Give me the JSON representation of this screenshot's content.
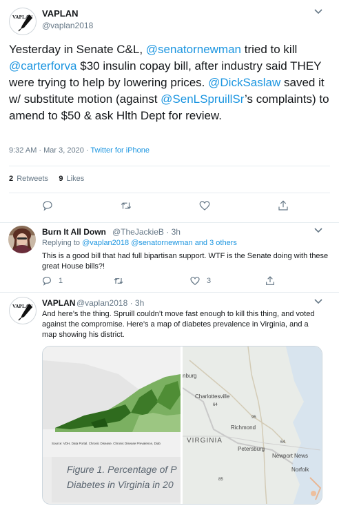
{
  "main_tweet": {
    "author": "VAPLAN",
    "handle": "@vaplan2018",
    "avatar_text": "VAPLAN",
    "body": {
      "t1": "Yesterday in Senate C&L, ",
      "m1": "@senatornewman",
      "t2": " tried to kill ",
      "m2": "@carterforva",
      "t3": " $30 insulin copay bill, after industry said THEY were trying to help by lowering prices. ",
      "m3": "@DickSaslaw",
      "t4": " saved it w/ substitute motion (against ",
      "m4": "@SenLSpruillSr",
      "t5": "’s complaints) to amend to $50 & ask Hlth Dept for review."
    },
    "timestamp": "9:32 AM · Mar 3, 2020 · ",
    "source": "Twitter for iPhone",
    "retweets_count": "2",
    "retweets_label": "Retweets",
    "likes_count": "9",
    "likes_label": "Likes"
  },
  "reply_1": {
    "author": "Burn It All Down",
    "handle": "@TheJackieB",
    "time": "· 3h",
    "replying_prefix": "Replying to ",
    "replying_to": "@vaplan2018 @senatornewman and 3 others",
    "text": "This is a good bill that had full bipartisan support. WTF is the Senate doing with these great House bills?!",
    "reply_count": "1",
    "retweet_count": "",
    "like_count": "3"
  },
  "reply_2": {
    "author": "VAPLAN",
    "handle": "@vaplan2018",
    "time": "· 3h",
    "avatar_text": "VAPLAN",
    "text": "And here’s the thing. Spruill couldn’t move fast enough to kill this thing, and voted against the compromise. Here’s a map of diabetes prevalence in Virginia, and a map showing his district.",
    "card": {
      "map_source": "Source: VDH, Data Portal. Chronic Disease. Chronic Disease Prevalence, Diab",
      "caption_line1": "Figure 1. Percentage of P",
      "caption_line2": "Diabetes in Virginia in 20",
      "map_labels": {
        "charlottesville": "Charlottesville",
        "richmond": "Richmond",
        "virginia": "VIRGINIA",
        "petersburg": "Petersburg",
        "newport_news": "Newport News",
        "norfolk": "Norfolk",
        "burg": "nburg",
        "route_64a": "64",
        "route_64b": "64",
        "route_95": "95",
        "route_85": "85"
      }
    }
  },
  "colors": {
    "link": "#1b95e0",
    "muted": "#657786",
    "text": "#14171a",
    "divider": "#e6ecf0",
    "map_dark_green": "#2f6b1e",
    "map_light_green": "#7bb061"
  },
  "icons": [
    "caret-down-icon",
    "reply-icon",
    "retweet-icon",
    "like-icon",
    "share-icon",
    "pen-nib-icon"
  ]
}
